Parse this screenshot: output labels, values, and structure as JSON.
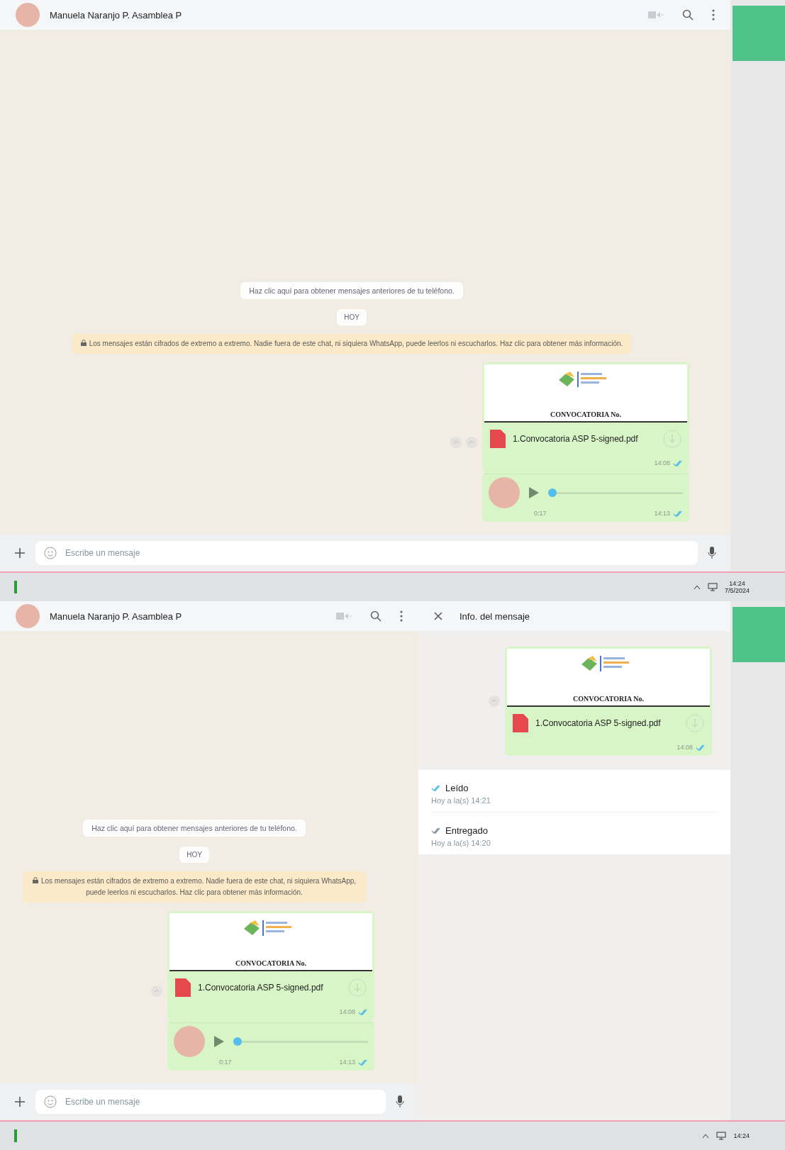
{
  "screens": [
    {
      "chat": {
        "contact": "Manuela Naranjo P. Asamblea P",
        "notice": "Haz clic aquí para obtener mensajes anteriores de tu teléfono.",
        "date_chip": "HOY",
        "encryption": "Los mensajes están cifrados de extremo a extremo. Nadie fuera de este chat, ni siquiera WhatsApp, puede leerlos ni escucharlos. Haz clic para obtener más información.",
        "messages": [
          {
            "kind": "document",
            "preview_title": "CONVOCATORIA No.",
            "file_name": "1.Convocatoria ASP 5-signed.pdf",
            "time": "14:08",
            "read": true
          },
          {
            "kind": "audio",
            "duration": "0:17",
            "time": "14:13",
            "read": true,
            "level": 0
          }
        ],
        "composer": {
          "placeholder": "Escribe un mensaje"
        }
      },
      "taskbar": {
        "time": "14:24",
        "date": "7/5/2024"
      }
    },
    {
      "chat": {
        "contact": "Manuela Naranjo P. Asamblea P",
        "notice": "Haz clic aquí para obtener mensajes anteriores de tu teléfono.",
        "date_chip": "HOY",
        "encryption": "Los mensajes están cifrados de extremo a extremo. Nadie fuera de este chat, ni siquiera WhatsApp, puede leerlos ni escucharlos. Haz clic para obtener más información.",
        "messages": [
          {
            "kind": "document",
            "preview_title": "CONVOCATORIA No.",
            "file_name": "1.Convocatoria ASP 5-signed.pdf",
            "time": "14:08",
            "read": true
          },
          {
            "kind": "audio",
            "duration": "0:17",
            "time": "14:13",
            "read": true,
            "level": 0
          }
        ],
        "composer": {
          "placeholder": "Escribe un mensaje"
        }
      },
      "info_panel": {
        "title": "Info. del mensaje",
        "message": {
          "kind": "document",
          "preview_title": "CONVOCATORIA No.",
          "file_name": "1.Convocatoria ASP 5-signed.pdf",
          "time": "14:08",
          "read": true
        },
        "receipts": [
          {
            "kind": "read",
            "label": "Leído",
            "time": "Hoy a la(s) 14:21"
          },
          {
            "kind": "delivered",
            "label": "Entregado",
            "time": "Hoy a la(s) 14:20"
          }
        ]
      },
      "taskbar": {
        "time": "14:24"
      }
    }
  ]
}
